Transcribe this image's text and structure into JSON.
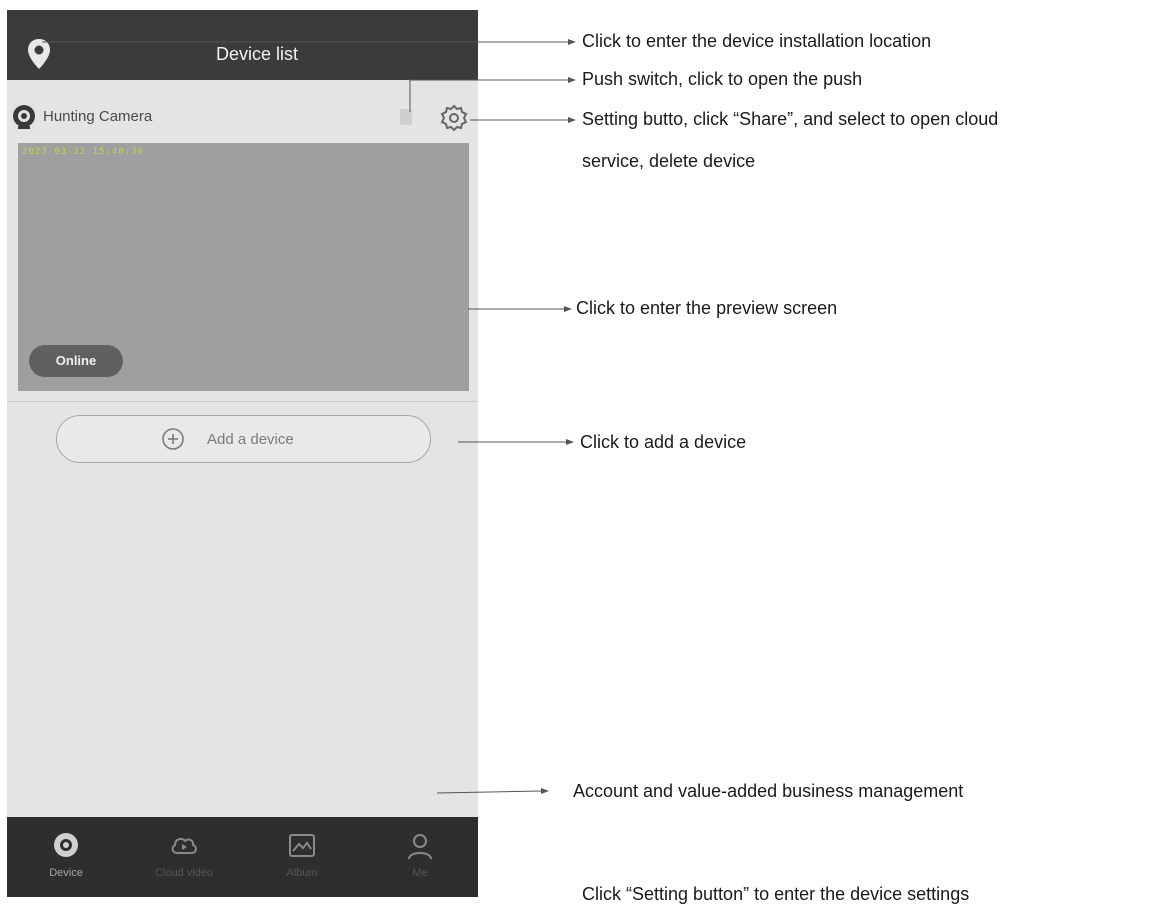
{
  "header": {
    "title": "Device list"
  },
  "device": {
    "name": "Hunting Camera",
    "osd": "2023-03-22 15:40:36",
    "status": "Online"
  },
  "actions": {
    "add_device": "Add a device"
  },
  "tabs": [
    {
      "label": "Device",
      "icon": "device-icon",
      "active": true
    },
    {
      "label": "Cloud video",
      "icon": "cloud-video-icon",
      "active": false
    },
    {
      "label": "Album",
      "icon": "album-icon",
      "active": false
    },
    {
      "label": "Me",
      "icon": "me-icon",
      "active": false
    }
  ],
  "annotations": {
    "location": "Click to enter the device installation location",
    "push": "Push switch, click to open the push",
    "settings_line1": "Setting butto, click “Share”, and select to open cloud",
    "settings_line2": "service, delete device",
    "preview": "Click to enter the preview screen",
    "add": "Click to add a device",
    "account": "Account and value-added business management",
    "cutoff": "Click “Setting button” to enter the device settings"
  },
  "colors": {
    "titlebar": "#3b3b3b",
    "screen_bg": "#e4e4e4",
    "preview_bg": "#9f9f9f",
    "tabbar": "#2e2e2e",
    "osd_text": "#c3d34a"
  }
}
